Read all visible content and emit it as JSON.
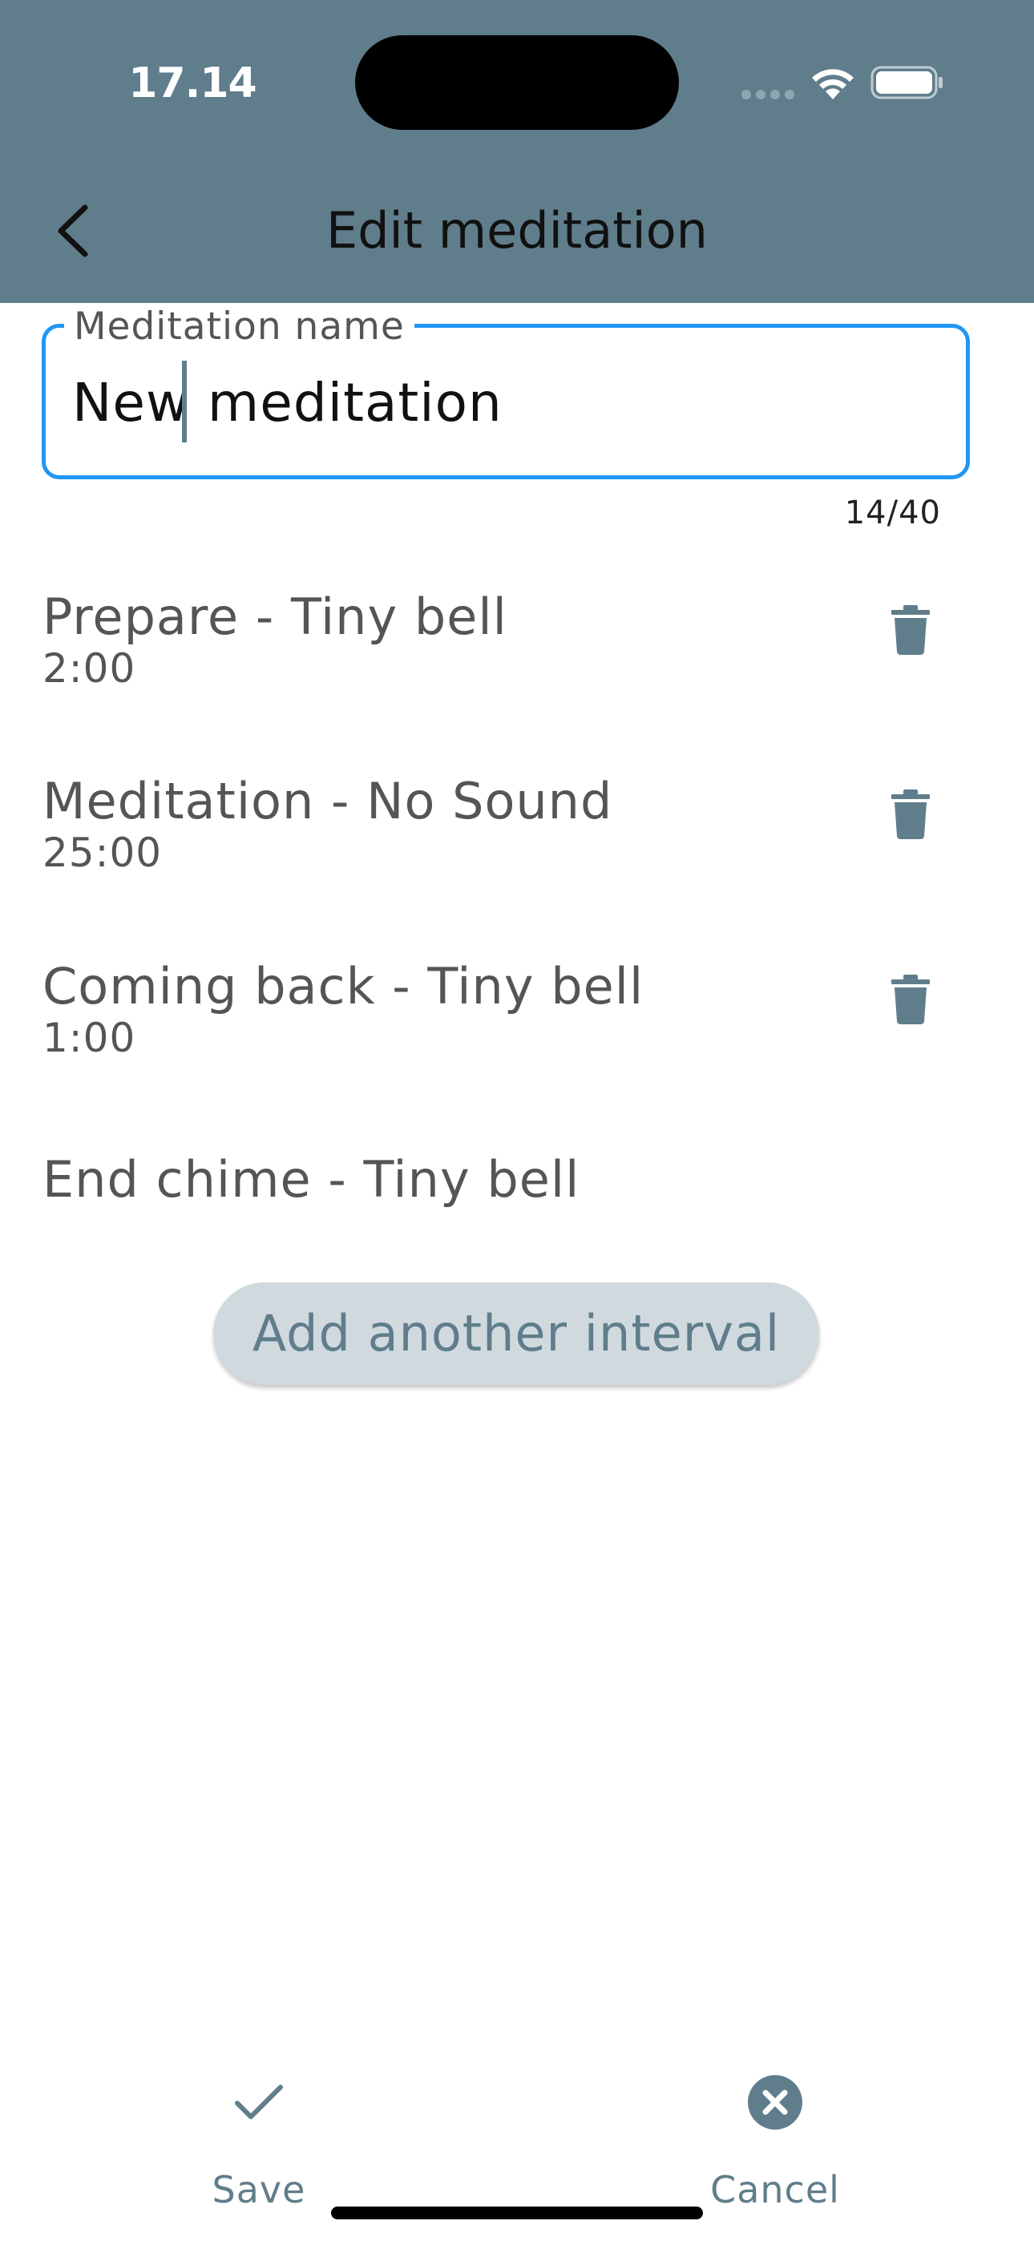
{
  "status_bar": {
    "time": "17.14"
  },
  "header": {
    "title": "Edit meditation",
    "back_icon": "chevron-left-icon"
  },
  "name_field": {
    "label": "Meditation name",
    "value": "New meditation",
    "counter": "14/40",
    "focused": true
  },
  "intervals": [
    {
      "title": "Prepare - Tiny bell",
      "duration": "2:00",
      "deletable": true
    },
    {
      "title": "Meditation - No Sound",
      "duration": "25:00",
      "deletable": true
    },
    {
      "title": "Coming back - Tiny bell",
      "duration": "1:00",
      "deletable": true
    },
    {
      "title": "End chime - Tiny bell",
      "duration": "",
      "deletable": false
    }
  ],
  "add_interval_label": "Add another interval",
  "bottom_bar": {
    "save_label": "Save",
    "save_icon": "checkmark-icon",
    "cancel_label": "Cancel",
    "cancel_icon": "close-circle-icon"
  },
  "colors": {
    "app_bar": "#607d8b",
    "accent": "#2196f3",
    "button_background": "#d0d9de",
    "text_secondary": "#555555"
  }
}
